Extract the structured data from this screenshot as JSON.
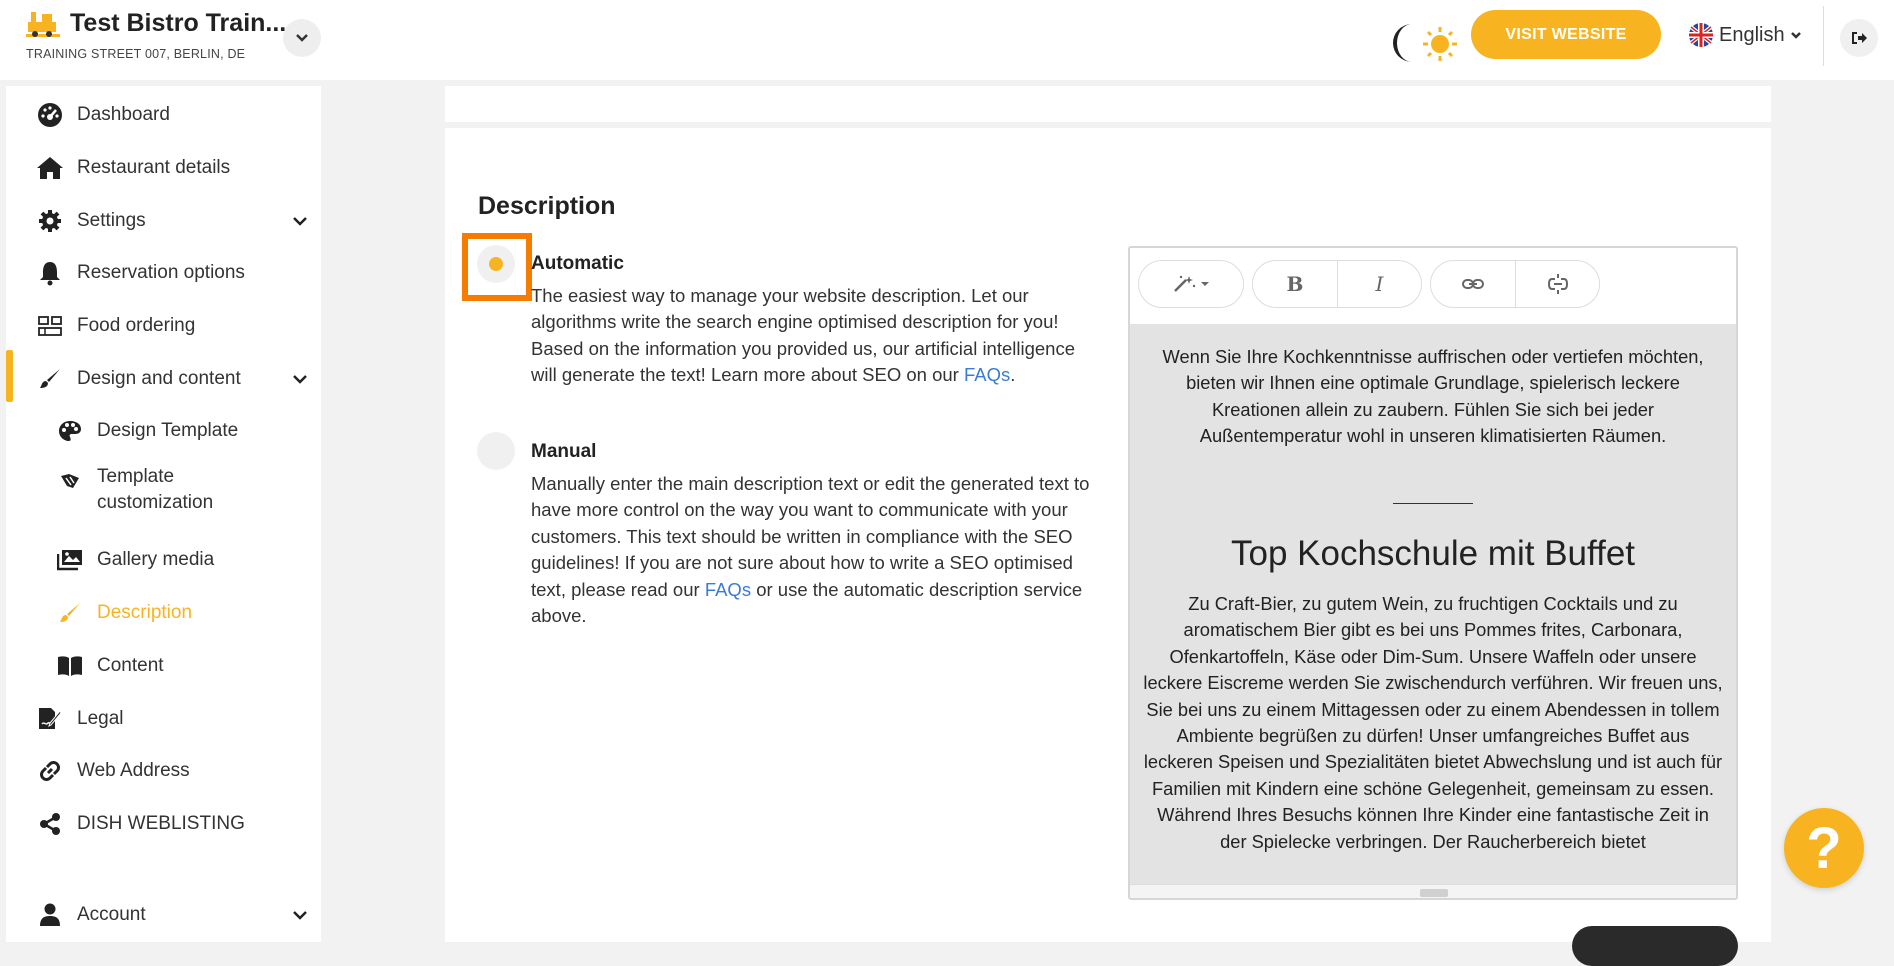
{
  "header": {
    "restaurant_name": "Test Bistro Train...",
    "address": "TRAINING STREET 007, BERLIN, DE",
    "visit_button": "VISIT WEBSITE",
    "language": "English"
  },
  "sidebar": {
    "items": [
      {
        "label": "Dashboard",
        "icon": "dashboard-icon"
      },
      {
        "label": "Restaurant details",
        "icon": "home-icon"
      },
      {
        "label": "Settings",
        "icon": "gear-icon"
      },
      {
        "label": "Reservation options",
        "icon": "bell-icon"
      },
      {
        "label": "Food ordering",
        "icon": "food-ordering-icon"
      },
      {
        "label": "Design and content",
        "icon": "brush-icon"
      },
      {
        "label": "Design Template",
        "icon": "palette-icon"
      },
      {
        "label": "Template",
        "label2": "customization",
        "icon": "template-icon"
      },
      {
        "label": "Gallery media",
        "icon": "gallery-icon"
      },
      {
        "label": "Description",
        "icon": "pencil-icon"
      },
      {
        "label": "Content",
        "icon": "book-icon"
      },
      {
        "label": "Legal",
        "icon": "legal-icon"
      },
      {
        "label": "Web Address",
        "icon": "link-icon"
      },
      {
        "label": "DISH WEBLISTING",
        "icon": "share-icon"
      },
      {
        "label": "Account",
        "icon": "user-icon"
      }
    ]
  },
  "main": {
    "section_title": "Description",
    "automatic": {
      "title": "Automatic",
      "text_before": "The easiest way to manage your website description. Let our algorithms write the search engine optimised description for you! Based on the information you provided us, our artificial intelligence will generate the text! Learn more about SEO on our ",
      "link": "FAQs",
      "text_after": ".",
      "selected": true
    },
    "manual": {
      "title": "Manual",
      "text_before": "Manually enter the main description text or edit the generated text to have more control on the way you want to communicate with your customers. This text should be written in compliance with the SEO guidelines! If you are not sure about how to write a SEO optimised text, please read our ",
      "link": "FAQs",
      "text_after": " or use the automatic description service above.",
      "selected": false
    }
  },
  "editor": {
    "toolbar": {
      "magic": "magic-wand-icon",
      "bold": "B",
      "italic": "I",
      "link": "link-icon",
      "unlink": "unlink-icon"
    },
    "intro": "Wenn Sie Ihre Kochkenntnisse auffrischen oder vertiefen möchten, bieten wir Ihnen eine optimale Grundlage, spielerisch leckere Kreationen allein zu zaubern. Fühlen Sie sich bei jeder Außentemperatur wohl in unseren klimatisierten Räumen.",
    "heading": "Top Kochschule mit Buffet",
    "body": "Zu Craft-Bier, zu gutem Wein, zu fruchtigen Cocktails und zu aromatischem Bier gibt es bei uns Pommes frites, Carbonara, Ofenkartoffeln, Käse oder Dim-Sum. Unsere Waffeln oder unsere leckere Eiscreme werden Sie zwischendurch verführen. Wir freuen uns, Sie bei uns zu einem Mittagessen oder zu einem Abendessen in tollem Ambiente begrüßen zu dürfen! Unser umfangreiches Buffet aus leckeren Speisen und Spezialitäten bietet Abwechslung und ist auch für Familien mit Kindern eine schöne Gelegenheit, gemeinsam zu essen. Während Ihres Besuchs können Ihre Kinder eine fantastische Zeit in der Spielecke verbringen. Der Raucherbereich bietet"
  },
  "help": {
    "label": "?"
  },
  "colors": {
    "accent": "#f8b420",
    "highlight": "#f57c00",
    "link": "#3a7bd5"
  }
}
